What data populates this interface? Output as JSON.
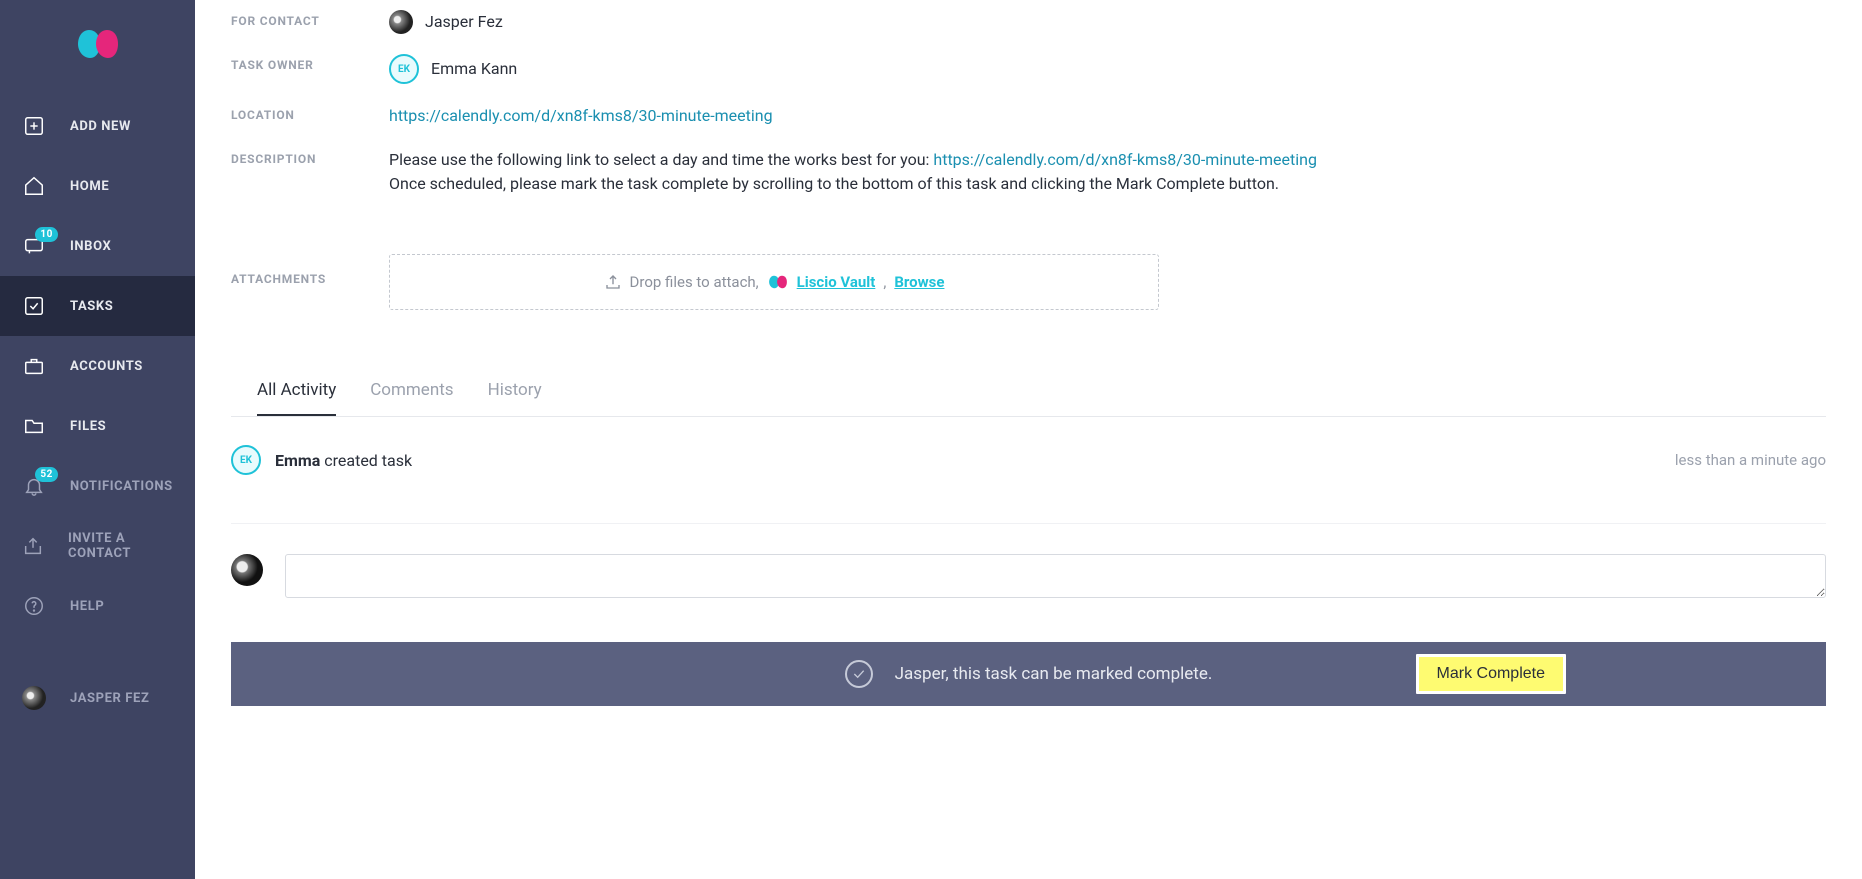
{
  "sidebar": {
    "items": [
      {
        "label": "ADD NEW",
        "icon": "plus-square-icon"
      },
      {
        "label": "HOME",
        "icon": "home-icon"
      },
      {
        "label": "INBOX",
        "icon": "inbox-icon",
        "badge": "10"
      },
      {
        "label": "TASKS",
        "icon": "check-square-icon",
        "active": true
      },
      {
        "label": "ACCOUNTS",
        "icon": "briefcase-icon"
      },
      {
        "label": "FILES",
        "icon": "folder-icon"
      },
      {
        "label": "NOTIFICATIONS",
        "icon": "bell-icon",
        "badge": "52",
        "dim": true
      },
      {
        "label": "INVITE A CONTACT",
        "icon": "share-icon",
        "dim": true
      },
      {
        "label": "HELP",
        "icon": "help-icon",
        "dim": true
      }
    ],
    "user": {
      "name": "JASPER FEZ"
    }
  },
  "detail": {
    "for_contact_label": "FOR CONTACT",
    "for_contact_name": "Jasper Fez",
    "task_owner_label": "TASK OWNER",
    "task_owner_name": "Emma Kann",
    "task_owner_initials": "EK",
    "location_label": "LOCATION",
    "location_url": "https://calendly.com/d/xn8f-kms8/30-minute-meeting",
    "description_label": "DESCRIPTION",
    "description_pre": "Please use the following link to select a day and time the works best for you: ",
    "description_link": "https://calendly.com/d/xn8f-kms8/30-minute-meeting",
    "description_line2": "Once scheduled, please mark the task complete by scrolling to the bottom of this task and clicking the Mark Complete button.",
    "attachments_label": "ATTACHMENTS",
    "drop_text": "Drop files to attach,",
    "vault_text": "Liscio Vault",
    "separator": ",",
    "browse_text": "Browse"
  },
  "tabs": {
    "all_activity": "All Activity",
    "comments": "Comments",
    "history": "History"
  },
  "activity": {
    "actor": "Emma",
    "action": " created task",
    "time": "less than a minute ago",
    "actor_initials": "EK"
  },
  "comment": {
    "placeholder": ""
  },
  "complete": {
    "message": "Jasper, this task can be marked complete.",
    "button": "Mark Complete"
  }
}
